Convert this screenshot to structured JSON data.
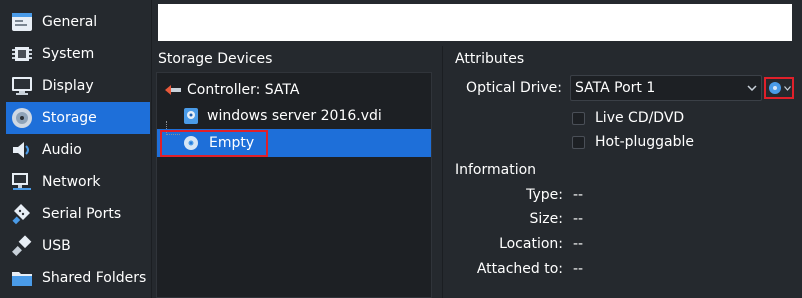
{
  "sidebar": {
    "items": [
      {
        "label": "General",
        "icon": "general-icon"
      },
      {
        "label": "System",
        "icon": "chip-icon"
      },
      {
        "label": "Display",
        "icon": "monitor-icon"
      },
      {
        "label": "Storage",
        "icon": "disk-icon"
      },
      {
        "label": "Audio",
        "icon": "speaker-icon"
      },
      {
        "label": "Network",
        "icon": "network-icon"
      },
      {
        "label": "Serial Ports",
        "icon": "serial-port-icon"
      },
      {
        "label": "USB",
        "icon": "usb-icon"
      },
      {
        "label": "Shared Folders",
        "icon": "folder-icon"
      }
    ],
    "active_index": 3
  },
  "storage": {
    "section_title": "Storage Devices",
    "controller_label": "Controller: SATA",
    "disk_label": "windows server 2016.vdi",
    "optical_label": "Empty"
  },
  "attributes": {
    "section_title": "Attributes",
    "optical_drive_label": "Optical Drive:",
    "optical_drive_value": "SATA Port 1",
    "live_cd_label": "Live CD/DVD",
    "hot_pluggable_label": "Hot-pluggable"
  },
  "information": {
    "section_title": "Information",
    "type_label": "Type:",
    "type_value": "--",
    "size_label": "Size:",
    "size_value": "--",
    "location_label": "Location:",
    "location_value": "--",
    "attached_label": "Attached to:",
    "attached_value": "--"
  },
  "colors": {
    "accent": "#1e6fd9",
    "highlight_border": "#e0202a",
    "background": "#25292e"
  }
}
